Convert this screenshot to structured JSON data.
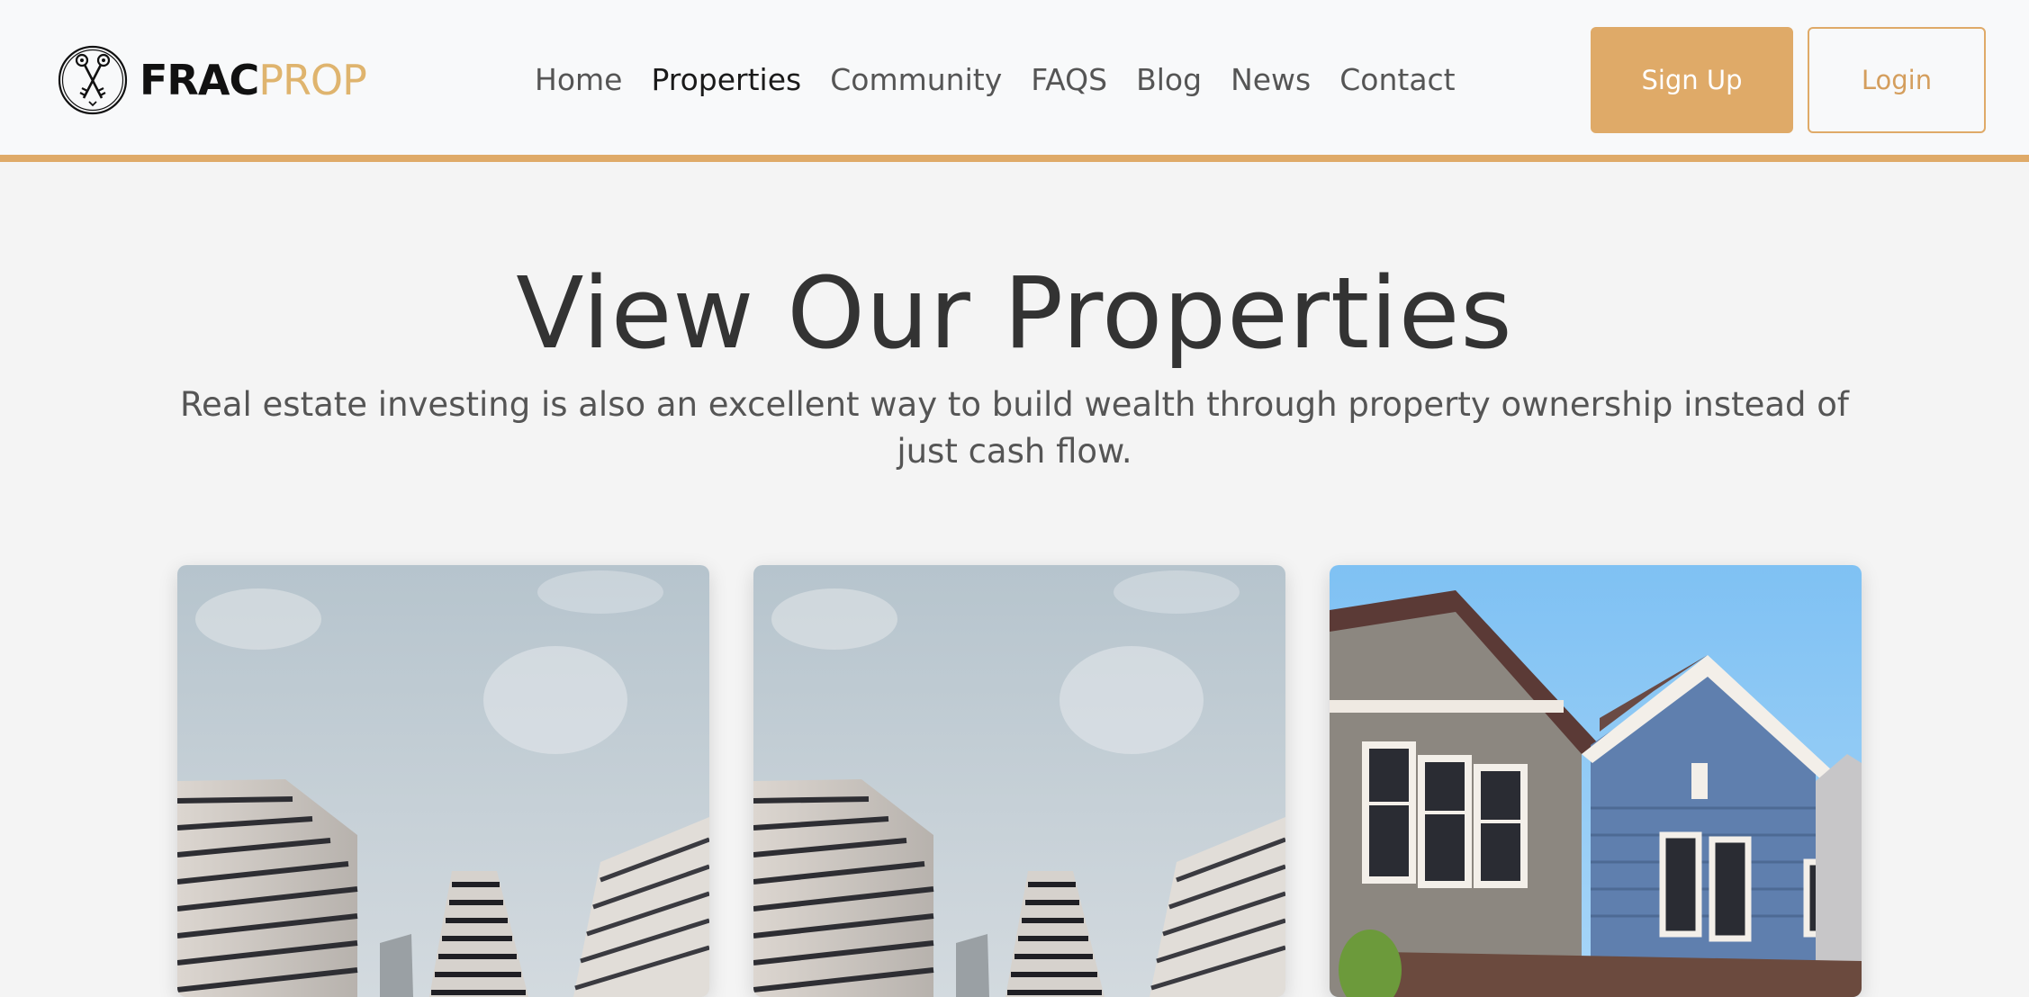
{
  "brand": {
    "logo_part1": "FRAC",
    "logo_part2": "PROP",
    "icon": "crossed-keys-icon",
    "colors": {
      "accent": "#dfaa68",
      "dark": "#111111"
    }
  },
  "nav": {
    "items": [
      {
        "label": "Home",
        "active": false
      },
      {
        "label": "Properties",
        "active": true
      },
      {
        "label": "Community",
        "active": false
      },
      {
        "label": "FAQS",
        "active": false
      },
      {
        "label": "Blog",
        "active": false
      },
      {
        "label": "News",
        "active": false
      },
      {
        "label": "Contact",
        "active": false
      }
    ]
  },
  "auth": {
    "signup_label": "Sign Up",
    "login_label": "Login"
  },
  "hero": {
    "title": "View Our Properties",
    "subtitle": "Real estate investing is also an excellent way to build wealth through property ownership instead of just cash flow."
  },
  "properties": [
    {
      "image": "high-rise-buildings-photo"
    },
    {
      "image": "high-rise-buildings-photo"
    },
    {
      "image": "suburban-house-photo"
    }
  ]
}
